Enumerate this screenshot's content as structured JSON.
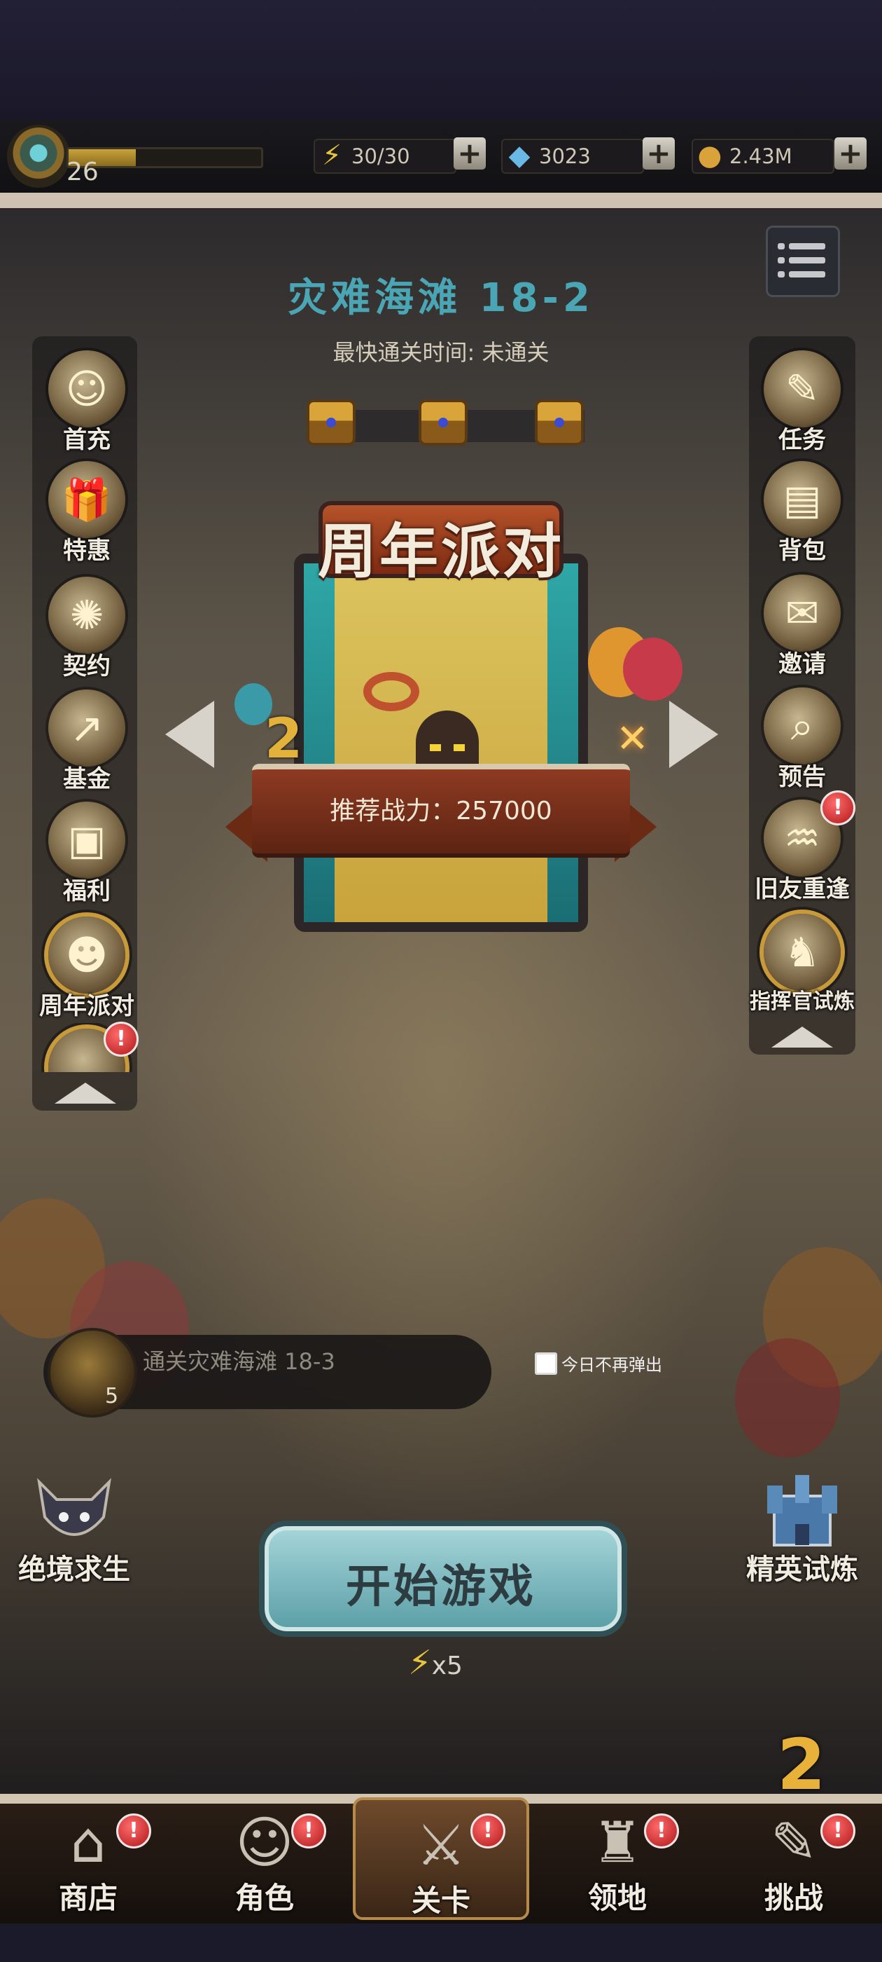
{
  "header": {
    "level": "26",
    "xp_progress": 0.35,
    "energy": "30/30",
    "gems": "3023",
    "gold": "2.43M"
  },
  "stage": {
    "title": "灾难海滩 18-2",
    "fastest_clear": "最快通关时间:   未通关"
  },
  "event": {
    "title": "周年派对",
    "recommended_power": "推荐战力：257000",
    "badge_number": "2"
  },
  "left_menu": [
    {
      "label": "首充",
      "icon": "character-portrait-icon"
    },
    {
      "label": "特惠",
      "icon": "gift-box-icon"
    },
    {
      "label": "契约",
      "icon": "contract-book-icon"
    },
    {
      "label": "基金",
      "icon": "fund-coins-icon"
    },
    {
      "label": "福利",
      "icon": "treasure-chest-icon"
    },
    {
      "label": "周年派对",
      "icon": "party-characters-icon"
    }
  ],
  "right_menu": [
    {
      "label": "任务",
      "icon": "quest-scroll-icon"
    },
    {
      "label": "背包",
      "icon": "backpack-icon"
    },
    {
      "label": "邀请",
      "icon": "invite-letter-icon"
    },
    {
      "label": "预告",
      "icon": "magnifier-book-icon"
    },
    {
      "label": "旧友重逢",
      "icon": "bat-creature-icon"
    },
    {
      "label": "指挥官试炼",
      "icon": "hooded-commander-icon"
    }
  ],
  "quest": {
    "text": "通关灾难海滩 18-3",
    "count": "5"
  },
  "no_popup_today": "今日不再弹出",
  "modes": {
    "left": "绝境求生",
    "right": "精英试炼"
  },
  "start_button": "开始游戏",
  "energy_cost": "x5",
  "bottom_nav": [
    {
      "label": "商店",
      "icon": "shop-stall-icon"
    },
    {
      "label": "角色",
      "icon": "hero-icon"
    },
    {
      "label": "关卡",
      "icon": "crossed-swords-icon"
    },
    {
      "label": "领地",
      "icon": "castle-icon"
    },
    {
      "label": "挑战",
      "icon": "challenge-map-icon"
    }
  ],
  "colors": {
    "stage_title": "#4aa6b5",
    "badge_red": "#d02020",
    "energy_yellow": "#e6c53a"
  }
}
